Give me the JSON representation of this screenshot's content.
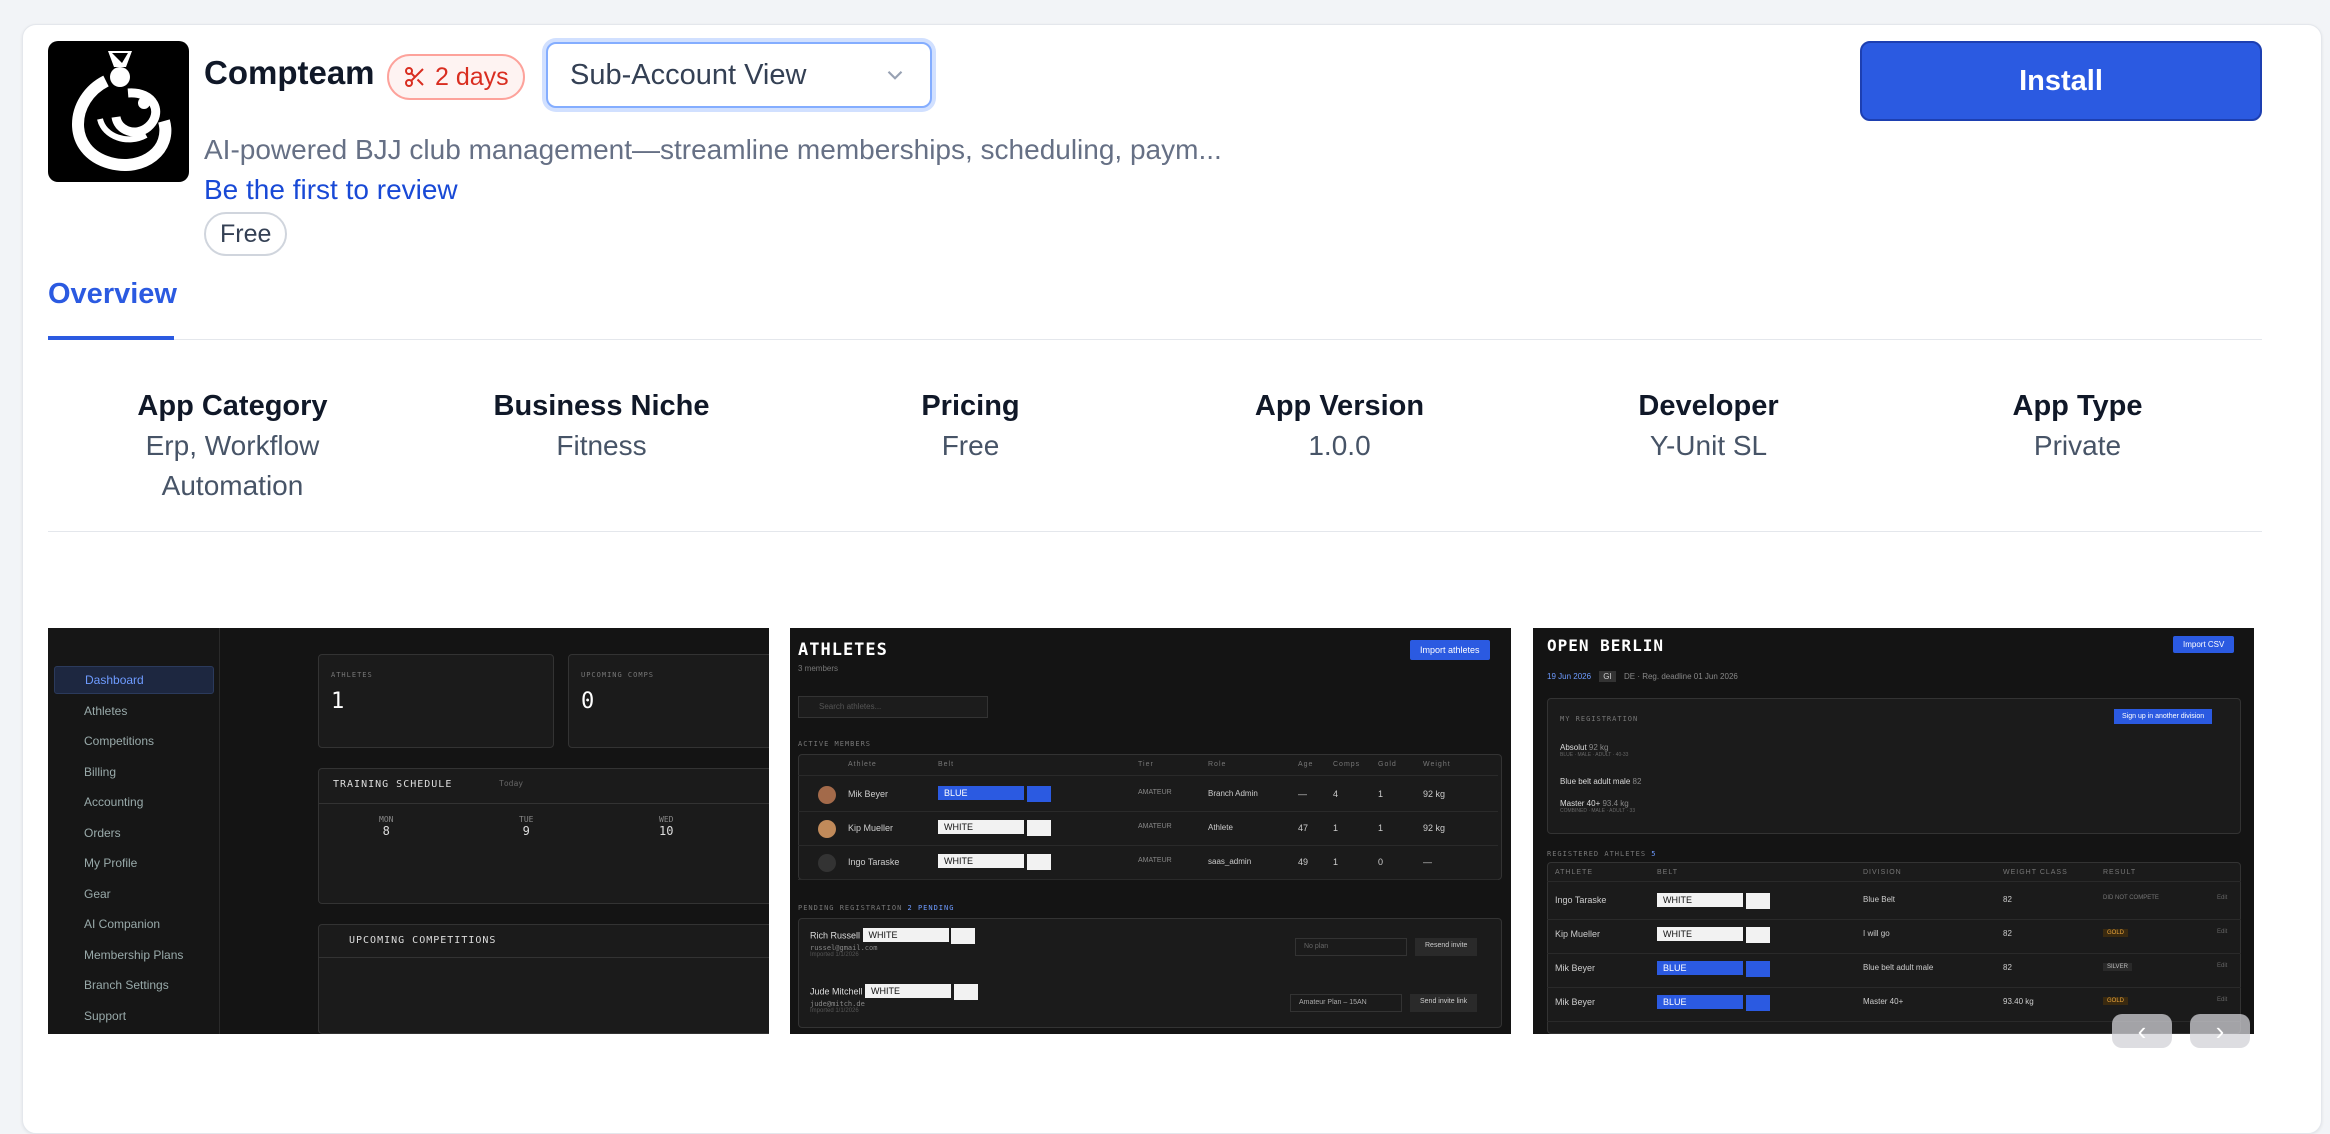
{
  "app": {
    "title": "Compteam",
    "trial_label": "2 days",
    "view_select": "Sub-Account View",
    "description": "AI-powered BJJ club management—streamline memberships, scheduling, paym...",
    "review_link": "Be the first to review",
    "price_badge": "Free",
    "install_label": "Install"
  },
  "tabs": [
    {
      "label": "Overview",
      "active": true
    }
  ],
  "meta": [
    {
      "label": "App Category",
      "value": "Erp, Workflow Automation"
    },
    {
      "label": "Business Niche",
      "value": "Fitness"
    },
    {
      "label": "Pricing",
      "value": "Free"
    },
    {
      "label": "App Version",
      "value": "1.0.0"
    },
    {
      "label": "Developer",
      "value": "Y-Unit SL"
    },
    {
      "label": "App Type",
      "value": "Private"
    }
  ],
  "screenshot1": {
    "sidebar": [
      "Dashboard",
      "Athletes",
      "Competitions",
      "Billing",
      "Accounting",
      "Orders",
      "My Profile",
      "Gear",
      "AI Companion",
      "Membership Plans",
      "Branch Settings",
      "Support"
    ],
    "athletes_label": "ATHLETES",
    "athletes_value": "1",
    "comps_label": "UPCOMING COMPS",
    "comps_value": "0",
    "schedule_title": "TRAINING SCHEDULE",
    "today": "Today",
    "days": [
      {
        "d": "MON",
        "n": "8"
      },
      {
        "d": "TUE",
        "n": "9"
      },
      {
        "d": "WED",
        "n": "10"
      }
    ],
    "upcoming_title": "UPCOMING COMPETITIONS"
  },
  "screenshot2": {
    "title": "ATHLETES",
    "subtitle": "3 members",
    "import_btn": "Import athletes",
    "search_placeholder": "Search athletes...",
    "section": "ACTIVE MEMBERS",
    "headers": [
      "Athlete",
      "Belt",
      "Tier",
      "Role",
      "Age",
      "Comps",
      "Gold",
      "Weight"
    ],
    "rows": [
      {
        "name": "Mik Beyer",
        "belt": "BLUE",
        "tier": "AMATEUR",
        "role": "Branch Admin",
        "age": "—",
        "comps": "4",
        "gold": "1",
        "weight": "92 kg"
      },
      {
        "name": "Kip Mueller",
        "belt": "WHITE",
        "tier": "AMATEUR",
        "role": "Athlete",
        "age": "47",
        "comps": "1",
        "gold": "1",
        "weight": "92 kg"
      },
      {
        "name": "Ingo Taraske",
        "belt": "WHITE",
        "tier": "AMATEUR",
        "role": "saas_admin",
        "age": "49",
        "comps": "1",
        "gold": "0",
        "weight": "—"
      }
    ],
    "pending_label": "PENDING REGISTRATION",
    "pending_count": "2 PENDING",
    "pending": [
      {
        "name": "Rich Russell",
        "belt": "WHITE",
        "email": "russel@gmail.com",
        "imported": "Imported 1/1/2026",
        "plan": "No plan",
        "action": "Resend invite"
      },
      {
        "name": "Jude Mitchell",
        "belt": "WHITE",
        "email": "jude@mitch.de",
        "imported": "Imported 1/1/2026",
        "plan": "Amateur Plan – 15AN",
        "action": "Send invite link"
      }
    ]
  },
  "screenshot3": {
    "title": "OPEN BERLIN",
    "import_btn": "Import CSV",
    "date": "19 Jun 2026",
    "tag": "GI",
    "country": "DE",
    "deadline": "Reg. deadline 01 Jun 2026",
    "my_reg": "MY REGISTRATION",
    "signup_btn": "Sign up in another division",
    "regs": [
      {
        "name": "Absolut",
        "weight": "92 kg",
        "sub": "BLUE · MALE · ADULT · 40-33"
      },
      {
        "name": "Blue belt adult male",
        "weight": "82",
        "sub": ""
      },
      {
        "name": "Master 40+",
        "weight": "93.4 kg",
        "sub": "COMBINED · MALE · ADULT · 33"
      }
    ],
    "registered_label": "REGISTERED ATHLETES",
    "registered_count": "5",
    "headers": [
      "ATHLETE",
      "BELT",
      "DIVISION",
      "WEIGHT CLASS",
      "RESULT"
    ],
    "rows": [
      {
        "name": "Ingo Taraske",
        "belt": "WHITE",
        "division": "Blue Belt",
        "weight": "82",
        "result": "DID NOT COMPETE"
      },
      {
        "name": "Kip Mueller",
        "belt": "WHITE",
        "division": "I will go",
        "weight": "82",
        "result": "GOLD"
      },
      {
        "name": "Mik Beyer",
        "belt": "BLUE",
        "division": "Blue belt adult male",
        "weight": "82",
        "result": "SILVER"
      },
      {
        "name": "Mik Beyer",
        "belt": "BLUE",
        "division": "Master 40+",
        "weight": "93.40 kg",
        "result": "GOLD"
      }
    ],
    "edit": "Edit"
  },
  "carousel": {
    "prev": "‹",
    "next": "›"
  },
  "colors": {
    "accent": "#2b5ae1",
    "trial": "#d92d20",
    "link": "#1849d6"
  }
}
